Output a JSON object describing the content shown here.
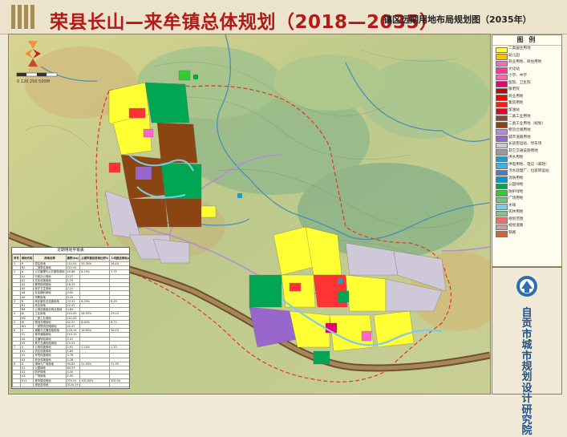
{
  "header": {
    "title": "荣县长山—来牟镇总体规划（2018—2035）",
    "subtitle": "镇区远期用地布局规划图（2035年）"
  },
  "scale_label": "0   120  250     500M",
  "legend": {
    "title": "图  例",
    "items": [
      {
        "color": "#ffff33",
        "label": "二类居住用地"
      },
      {
        "color": "#ffbf00",
        "label": "幼儿园"
      },
      {
        "color": "#ff66cc",
        "label": "商业用地、商住用地"
      },
      {
        "color": "#ff3399",
        "label": "文化站"
      },
      {
        "color": "#ff66a6",
        "label": "小学、中学"
      },
      {
        "color": "#e60073",
        "label": "医院、卫生院"
      },
      {
        "color": "#cc0000",
        "label": "敬老院"
      },
      {
        "color": "#ff0000",
        "label": "商业用地"
      },
      {
        "color": "#ff1a1a",
        "label": "集贸用地"
      },
      {
        "color": "#e6002e",
        "label": "加油站"
      },
      {
        "color": "#9e3d1f",
        "label": "二类工业用地"
      },
      {
        "color": "#8b4513",
        "label": "二类工业用地（规划）"
      },
      {
        "color": "#b58bd6",
        "label": "物流仓储用地"
      },
      {
        "color": "#9966cc",
        "label": "城市道路用地"
      },
      {
        "color": "#cccccc",
        "label": "长途客运站、停车场"
      },
      {
        "color": "#999999",
        "label": "其它交通设施用地"
      },
      {
        "color": "#1e9bd7",
        "label": "供水用地"
      },
      {
        "color": "#3cb4e6",
        "label": "供电用地、电信（邮政）"
      },
      {
        "color": "#5078c8",
        "label": "污水处理厂、垃圾转运站"
      },
      {
        "color": "#0099cc",
        "label": "消防用地"
      },
      {
        "color": "#00a651",
        "label": "公园绿地"
      },
      {
        "color": "#33cc33",
        "label": "防护绿地"
      },
      {
        "color": "#66cc66",
        "label": "广场用地"
      },
      {
        "color": "#7ccbe8",
        "label": "水域"
      },
      {
        "color": "#8bbf8b",
        "label": "农林用地"
      },
      {
        "color": "#ff6666",
        "label": "规划范围"
      },
      {
        "color": "#c8a0a0",
        "label": "规划道路"
      },
      {
        "color": "#cc6633",
        "label": "铁路"
      }
    ]
  },
  "institute": {
    "name": "自贡市城市规划设计研究院"
  },
  "land_use_table": {
    "title": "近期用地平衡表",
    "headers": [
      "序号",
      "用地代码",
      "用地名称",
      "面积(ha)",
      "占城市建设用地比例%",
      "人均建设用地(m²)"
    ],
    "rows": [
      [
        "1",
        "R",
        "居住用地",
        "101.91",
        "35.30%",
        "36.40"
      ],
      [
        "",
        "R2",
        "二类居住用地",
        "101.91",
        "",
        ""
      ],
      [
        "2",
        "A",
        "公共管理与公共服务用地",
        "29.66",
        "8.15%",
        "7.75"
      ],
      [
        "",
        "A1",
        "行政办公用地",
        "3.27",
        "",
        ""
      ],
      [
        "",
        "A2",
        "文化设施用地",
        "1.70",
        "",
        ""
      ],
      [
        "",
        "A3",
        "教育科研用地",
        "18.33",
        "",
        ""
      ],
      [
        "",
        "A5",
        "医疗卫生用地",
        "2.21",
        "",
        ""
      ],
      [
        "",
        "A6",
        "社会福利用地",
        "0.62",
        "",
        ""
      ],
      [
        "",
        "A9",
        "宗教用地",
        "0.20",
        "",
        ""
      ],
      [
        "3",
        "B",
        "商业服务业设施用地",
        "23.31",
        "6.25%",
        "6.29"
      ],
      [
        "",
        "B1",
        "商业用地",
        "22.47",
        "",
        ""
      ],
      [
        "",
        "B4",
        "公用设施营业网点用地",
        "0.84",
        "",
        ""
      ],
      [
        "4",
        "M",
        "工业用地",
        "101.00",
        "28.55%",
        "29.14"
      ],
      [
        "",
        "M2",
        "二类工业用地",
        "101.00",
        "",
        ""
      ],
      [
        "5",
        "W",
        "物流仓储用地",
        "42.47",
        "6.84%",
        "6.72"
      ],
      [
        "",
        "W1",
        "一类物流仓储用地",
        "42.47",
        "",
        ""
      ],
      [
        "6",
        "S",
        "道路与交通设施用地",
        "128.11",
        "16.60%",
        "16.53"
      ],
      [
        "",
        "S1",
        "城市道路用地",
        "110.13",
        "",
        ""
      ],
      [
        "",
        "S4",
        "交通场站用地",
        "2.47",
        "",
        ""
      ],
      [
        "",
        "S9",
        "其它交通设施用地",
        "15.51",
        "",
        ""
      ],
      [
        "7",
        "U",
        "公用设施用地",
        "2.91",
        "1.14%",
        "1.10"
      ],
      [
        "",
        "U1",
        "供应设施用地",
        "1.85",
        "",
        ""
      ],
      [
        "",
        "U2",
        "环境设施用地",
        "0.78",
        "",
        ""
      ],
      [
        "",
        "U3",
        "安全设施用地",
        "0.28",
        "",
        ""
      ],
      [
        "8",
        "G",
        "绿地与广场用地",
        "90.83",
        "21.40%",
        "21.95"
      ],
      [
        "",
        "G1",
        "公园绿地",
        "84.53",
        "",
        ""
      ],
      [
        "",
        "G2",
        "防护绿地",
        "4.30",
        "",
        ""
      ],
      [
        "",
        "G3",
        "广场用地",
        "2.00",
        "",
        ""
      ],
      [
        "",
        "H11",
        "城市建设用地",
        "370.91",
        "100.00%",
        "100.34"
      ],
      [
        "",
        "",
        "规划总用地",
        "3120.19",
        "",
        ""
      ]
    ]
  }
}
